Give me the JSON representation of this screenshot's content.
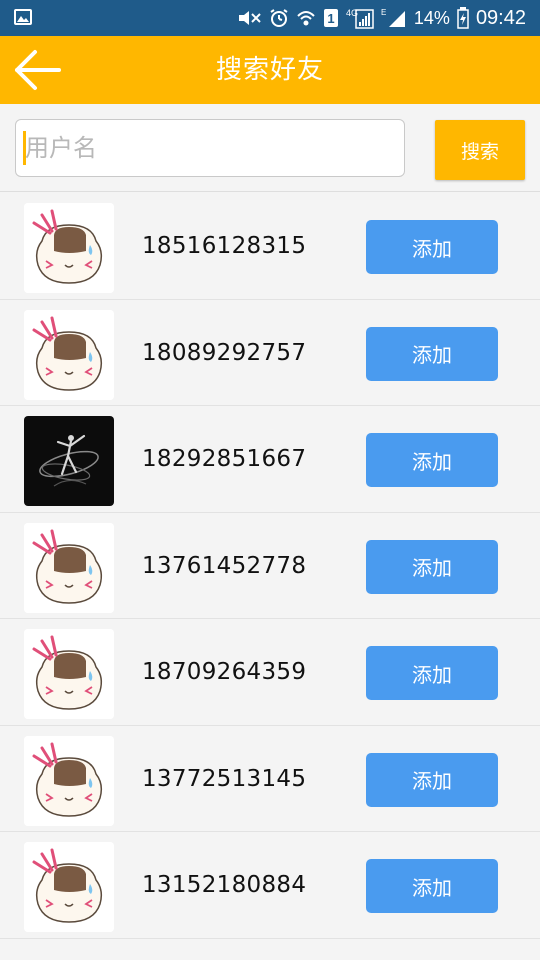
{
  "status_bar": {
    "battery": "14%",
    "time": "09:42",
    "network_label": "4G",
    "sim_label": "1",
    "data_label": "E",
    "icons": [
      "image-icon",
      "mute-icon",
      "alarm-icon",
      "wifi-icon",
      "sim-icon",
      "signal-icon",
      "signal-icon",
      "battery-icon"
    ]
  },
  "header": {
    "title": "搜索好友",
    "back_icon": "arrow-left-icon"
  },
  "search": {
    "placeholder": "用户名",
    "value": "",
    "button_label": "搜索"
  },
  "friends": [
    {
      "phone": "18516128315",
      "avatar": "cartoon-avatar",
      "add_label": "添加"
    },
    {
      "phone": "18089292757",
      "avatar": "cartoon-avatar",
      "add_label": "添加"
    },
    {
      "phone": "18292851667",
      "avatar": "dancer-photo-avatar",
      "add_label": "添加"
    },
    {
      "phone": "13761452778",
      "avatar": "cartoon-avatar",
      "add_label": "添加"
    },
    {
      "phone": "18709264359",
      "avatar": "cartoon-avatar",
      "add_label": "添加"
    },
    {
      "phone": "13772513145",
      "avatar": "cartoon-avatar",
      "add_label": "添加"
    },
    {
      "phone": "13152180884",
      "avatar": "cartoon-avatar",
      "add_label": "添加"
    }
  ],
  "colors": {
    "status_bar": "#1f5b8a",
    "accent": "#ffb700",
    "add_button": "#4a9bef",
    "background": "#f4f4f4"
  }
}
